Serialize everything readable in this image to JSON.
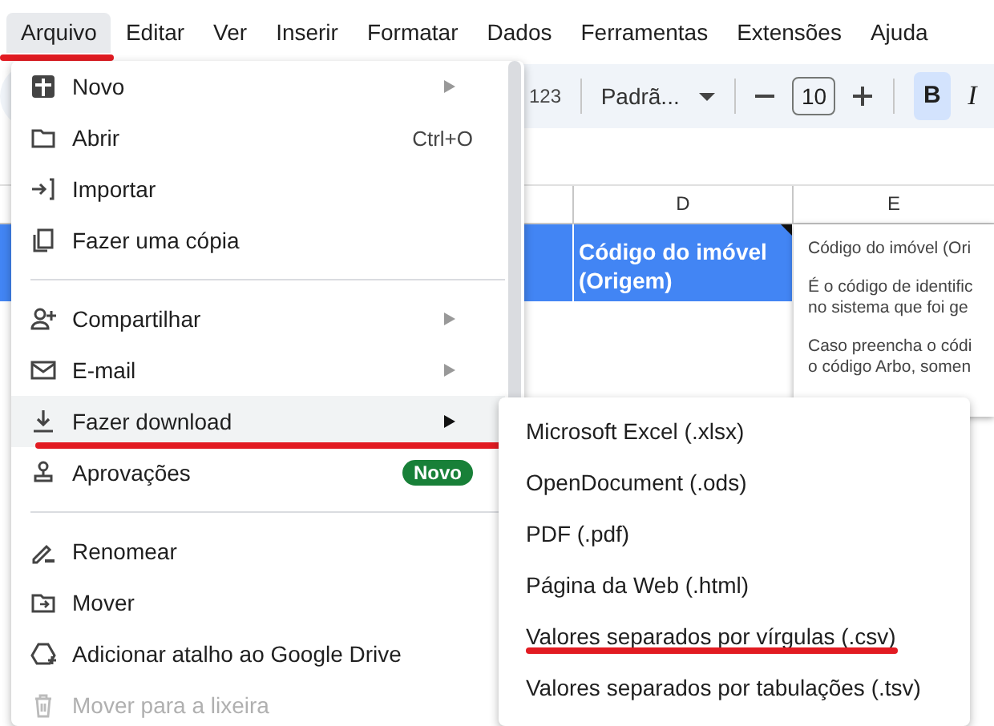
{
  "menubar": [
    {
      "label": "Arquivo",
      "selected": true,
      "underlined": true
    },
    {
      "label": "Editar",
      "selected": false,
      "underlined": false
    },
    {
      "label": "Ver",
      "selected": false,
      "underlined": false
    },
    {
      "label": "Inserir",
      "selected": false,
      "underlined": false
    },
    {
      "label": "Formatar",
      "selected": false,
      "underlined": false
    },
    {
      "label": "Dados",
      "selected": false,
      "underlined": false
    },
    {
      "label": "Ferramentas",
      "selected": false,
      "underlined": false
    },
    {
      "label": "Extensões",
      "selected": false,
      "underlined": false
    },
    {
      "label": "Ajuda",
      "selected": false,
      "underlined": false
    }
  ],
  "toolbar": {
    "number_format": "123",
    "font": "Padrã...",
    "font_size": "10",
    "style_buttons": [
      {
        "label": "B",
        "kind": "bold",
        "selected": true
      },
      {
        "label": "I",
        "kind": "italic",
        "selected": false
      }
    ]
  },
  "sheet": {
    "columns": [
      {
        "label": "D"
      },
      {
        "label": "E"
      }
    ],
    "header_cells": [
      {
        "text": "Código do imóvel (Origem)",
        "has_note": true
      }
    ]
  },
  "note": {
    "paragraphs": [
      [
        "Código do imóvel (Ori"
      ],
      [
        "É o código de identific",
        "no sistema que foi ge"
      ],
      [
        "Caso preencha o códi",
        "o código Arbo, somen"
      ]
    ]
  },
  "file_menu": {
    "sections": [
      [
        {
          "label": "Novo",
          "submenu": true,
          "highlighted": false,
          "disabled": false,
          "underlined": false
        },
        {
          "label": "Abrir",
          "shortcut": "Ctrl+O",
          "submenu": false,
          "highlighted": false,
          "disabled": false,
          "underlined": false
        },
        {
          "label": "Importar",
          "submenu": false,
          "highlighted": false,
          "disabled": false,
          "underlined": false
        },
        {
          "label": "Fazer uma cópia",
          "submenu": false,
          "highlighted": false,
          "disabled": false,
          "underlined": false
        }
      ],
      [
        {
          "label": "Compartilhar",
          "submenu": true,
          "highlighted": false,
          "disabled": false,
          "underlined": false
        },
        {
          "label": "E-mail",
          "submenu": true,
          "highlighted": false,
          "disabled": false,
          "underlined": false
        },
        {
          "label": "Fazer download",
          "submenu": true,
          "highlighted": true,
          "disabled": false,
          "underlined": true
        },
        {
          "label": "Aprovações",
          "badge": "Novo",
          "submenu": false,
          "highlighted": false,
          "disabled": false,
          "underlined": false
        }
      ],
      [
        {
          "label": "Renomear",
          "submenu": false,
          "highlighted": false,
          "disabled": false,
          "underlined": false
        },
        {
          "label": "Mover",
          "submenu": false,
          "highlighted": false,
          "disabled": false,
          "underlined": false
        },
        {
          "label": "Adicionar atalho ao Google Drive",
          "submenu": false,
          "highlighted": false,
          "disabled": false,
          "underlined": false
        },
        {
          "label": "Mover para a lixeira",
          "submenu": false,
          "highlighted": false,
          "disabled": true,
          "underlined": false
        }
      ]
    ]
  },
  "download_menu": {
    "items": [
      {
        "label": "Microsoft Excel (.xlsx)",
        "underlined": false
      },
      {
        "label": "OpenDocument (.ods)",
        "underlined": false
      },
      {
        "label": "PDF (.pdf)",
        "underlined": false
      },
      {
        "label": "Página da Web (.html)",
        "underlined": false
      },
      {
        "label": "Valores separados por vírgulas (.csv)",
        "underlined": true
      },
      {
        "label": "Valores separados por tabulações (.tsv)",
        "underlined": false
      }
    ]
  }
}
